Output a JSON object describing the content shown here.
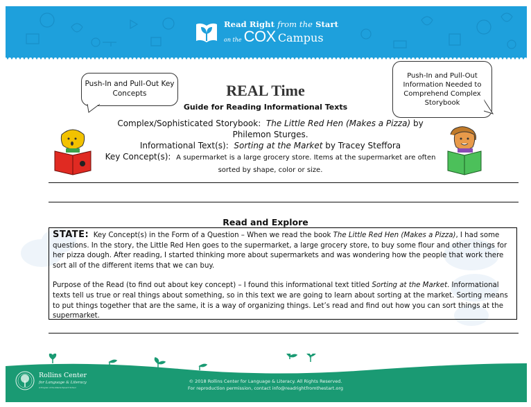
{
  "header": {
    "brand_line1_a": "Read Right ",
    "brand_line1_b": "from the",
    "brand_line1_c": " Start",
    "brand_onthe": "on the",
    "brand_cox": "COX",
    "brand_campus": "Campus",
    "logo_icon": "open-book-sprout-icon",
    "color": "#1ea0dc"
  },
  "bubbles": {
    "left": "Push-In and Pull-Out Key Concepts",
    "right": "Push-In and Pull-Out Information Needed to Comprehend Complex Storybook"
  },
  "title": "REAL Time",
  "subtitle": "Guide for Reading Informational Texts",
  "meta": {
    "storybook_label": "Complex/Sophisticated Storybook:",
    "storybook_title": "The Little Red Hen (Makes a Pizza)",
    "storybook_by": "by Philemon Sturges.",
    "informational_label": "Informational Text(s):",
    "informational_title": "Sorting at the Market",
    "informational_by": "by Tracey Steffora",
    "key_concept_label": "Key Concept(s):",
    "key_concept_text": "A supermarket is a large grocery store. Items at the supermarket are often sorted by shape, color or size."
  },
  "section_title": "Read and Explore",
  "state": {
    "label": "STATE:",
    "text_a": "Key Concept(s) in the Form of a Question – When we read the book ",
    "book_title": "The Little Red Hen (Makes a Pizza)",
    "text_b": ", I had some questions.  In the story, the Little Red Hen goes to the supermarket, a large grocery store, to buy some flour and other things for her pizza dough. After reading, I started thinking more about supermarkets and was wondering how the people that work there sort all of the different items that we can buy."
  },
  "purpose": {
    "text_a": "Purpose of the Read (to find out about key concept) – I found this informational text titled ",
    "book_title": "Sorting at the Market",
    "text_b": ". Informational texts tell us true or real things about something, so in this text we are going to learn about sorting at the market.  Sorting means to put things together that are the same, it is a way of organizing things. Let’s read and find out how you can sort things at the supermarket."
  },
  "footer": {
    "org_name": "Rollins Center",
    "org_sub": "for Language & Literacy",
    "org_tag": "A Program of the Atlanta Speech School",
    "copyright": "© 2018 Rollins Center for Language & Literacy. All Rights Reserved.",
    "permission": "For reproduction permission, contact info@readrightfromthestart.org",
    "color": "#1a9a73"
  }
}
